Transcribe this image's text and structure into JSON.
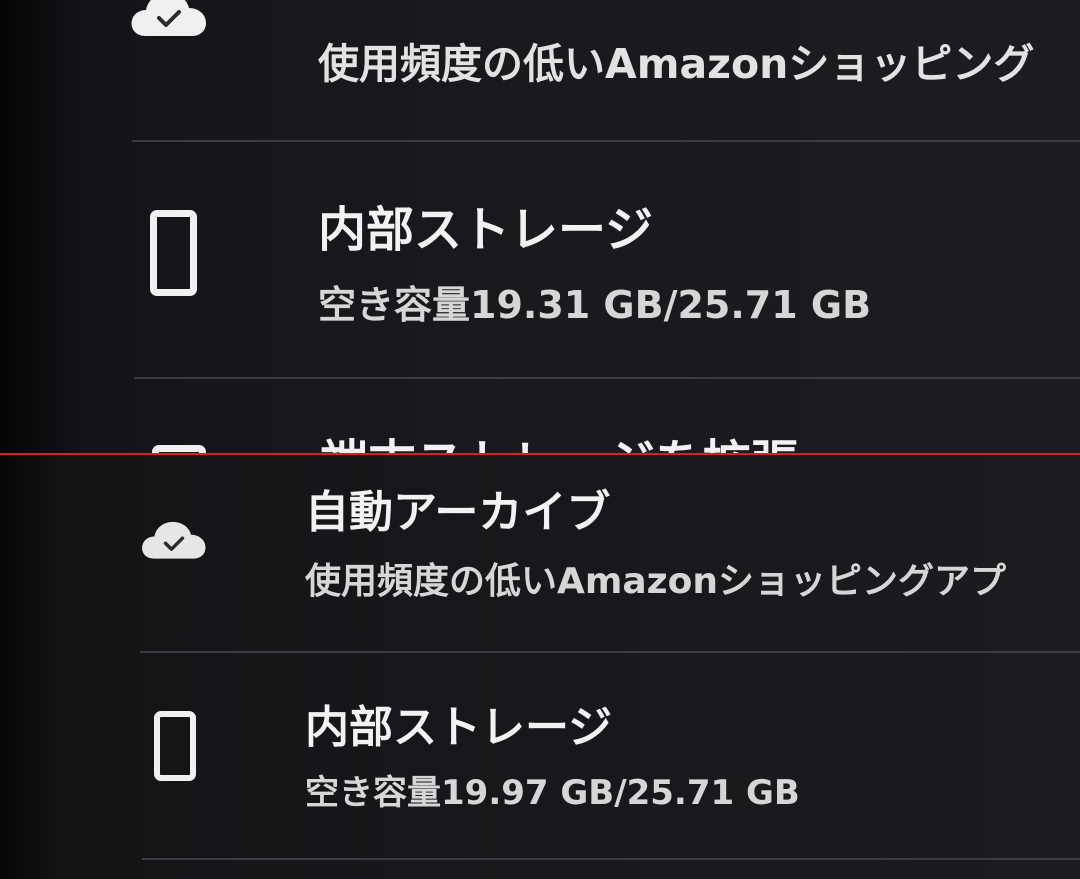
{
  "colors": {
    "background": "#17181b",
    "text_primary": "#f2f2f2",
    "text_secondary": "#d6d6d6",
    "separator": "#3b3c40",
    "capture_divider": "#c8262a"
  },
  "top_capture": {
    "auto_archive": {
      "icon": "cloud-check-icon",
      "description": "使用頻度の低いAmazonショッピング"
    },
    "internal_storage": {
      "icon": "tablet-device-icon",
      "title": "内部ストレージ",
      "detail": "空き容量19.31 GB/25.71 GB"
    },
    "expand_storage": {
      "icon": "device-icon",
      "title": "端末ストレージを拡張"
    }
  },
  "bottom_capture": {
    "auto_archive": {
      "icon": "cloud-check-icon",
      "title": "自動アーカイブ",
      "description": "使用頻度の低いAmazonショッピングアプ"
    },
    "internal_storage": {
      "icon": "tablet-device-icon",
      "title": "内部ストレージ",
      "detail": "空き容量19.97 GB/25.71 GB"
    }
  }
}
